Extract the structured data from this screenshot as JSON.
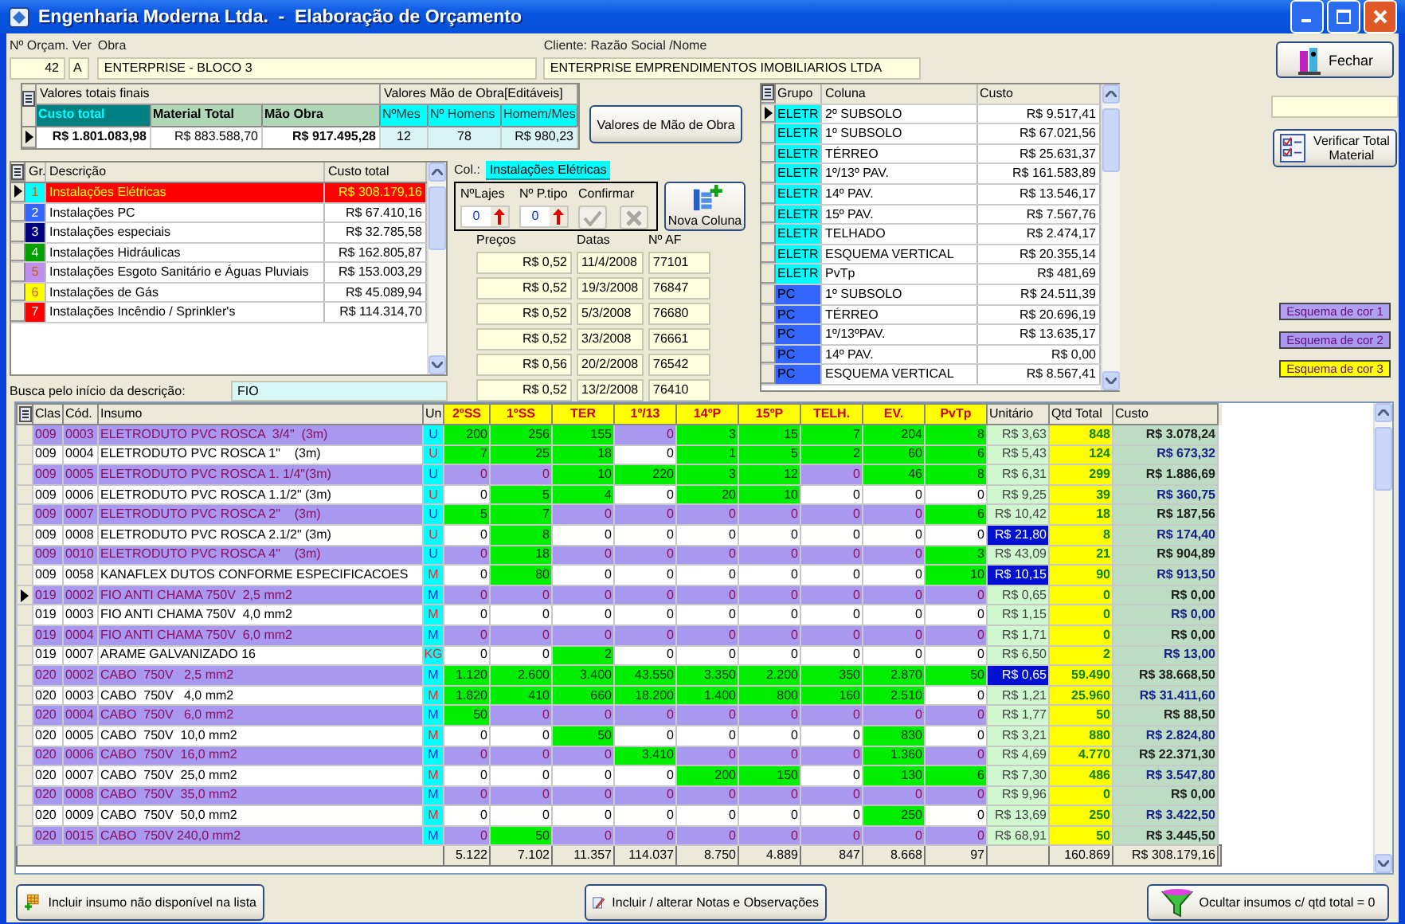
{
  "window": {
    "title": "Engenharia Moderna Ltda.  -  Elaboração de Orçamento"
  },
  "header_fields": {
    "orcamento_label": "Nº Orçam. Ver",
    "orcamento": "42",
    "versao": "A",
    "obra_label": "Obra",
    "obra": "ENTERPRISE - BLOCO 3",
    "cliente_label": "Cliente: Razão Social /Nome",
    "cliente": "ENTERPRISE EMPRENDIMENTOS IMOBILIARIOS LTDA"
  },
  "totals": {
    "title": "Valores totais finais",
    "columns": [
      "Custo total",
      "Material Total",
      "Mão Obra"
    ],
    "values": [
      "R$ 1.801.083,98",
      "R$ 883.588,70",
      "R$ 917.495,28"
    ],
    "labor_title": "Valores Mão de Obra[Editáveis]",
    "labor_columns": [
      "NºMes",
      "Nº Homens",
      "Homem/Mes"
    ],
    "labor_values": [
      "12",
      "78",
      "R$ 980,23"
    ]
  },
  "labor_button": "Valores de Mão de Obra",
  "groups": {
    "columns": [
      "Gr.",
      "Descrição",
      "Custo total"
    ],
    "rows": [
      {
        "gr": "1",
        "descricao": "Instalações Elétricas",
        "custo": "R$ 308.179,16",
        "color": "#00ffff",
        "selected": true
      },
      {
        "gr": "2",
        "descricao": "Instalações PC",
        "custo": "R$ 67.410,16",
        "color": "#3366ff",
        "selected": false
      },
      {
        "gr": "3",
        "descricao": "Instalações especiais",
        "custo": "R$ 32.785,58",
        "color": "#000080",
        "selected": false
      },
      {
        "gr": "4",
        "descricao": "Instalações Hidráulicas",
        "custo": "R$ 162.805,87",
        "color": "#00a000",
        "selected": false
      },
      {
        "gr": "5",
        "descricao": "Instalações Esgoto Sanitário e Águas Pluviais",
        "custo": "R$ 153.003,29",
        "color": "#c090f0",
        "selected": false
      },
      {
        "gr": "6",
        "descricao": "Instalações de Gás",
        "custo": "R$ 45.089,94",
        "color": "#ffff00",
        "selected": false
      },
      {
        "gr": "7",
        "descricao": "Instalações Incêndio / Sprinkler's",
        "custo": "R$ 114.314,70",
        "color": "#ff0000",
        "selected": false
      }
    ]
  },
  "search": {
    "label": "Busca pelo início da descrição:",
    "value": "FIO"
  },
  "column_editor": {
    "col_label": "Col.:",
    "col_value": "Instalações Elétricas",
    "lajes_label": "NºLajes",
    "lajes": "0",
    "ptipo_label": "Nº P.tipo",
    "ptipo": "0",
    "confirm_label": "Confirmar",
    "confirm_disabled": true,
    "new_column": "Nova Coluna"
  },
  "prices": {
    "columns": [
      "Preços",
      "Datas",
      "Nº AF"
    ],
    "rows": [
      [
        "R$ 0,52",
        "11/4/2008",
        "77101"
      ],
      [
        "R$ 0,52",
        "19/3/2008",
        "76847"
      ],
      [
        "R$ 0,52",
        "5/3/2008",
        "76680"
      ],
      [
        "R$ 0,52",
        "3/3/2008",
        "76661"
      ],
      [
        "R$ 0,56",
        "20/2/2008",
        "76542"
      ],
      [
        "R$ 0,52",
        "13/2/2008",
        "76410"
      ]
    ]
  },
  "column_costs": {
    "columns": [
      "Grupo",
      "Coluna",
      "Custo"
    ],
    "rows": [
      {
        "grupo": "ELETR",
        "coluna": "2º SUBSOLO",
        "custo": "R$ 9.517,41",
        "color": "#00ffff",
        "selected": true
      },
      {
        "grupo": "ELETR",
        "coluna": "1º SUBSOLO",
        "custo": "R$ 67.021,56",
        "color": "#00ffff",
        "selected": false
      },
      {
        "grupo": "ELETR",
        "coluna": "TÉRREO",
        "custo": "R$ 25.631,37",
        "color": "#00ffff",
        "selected": false
      },
      {
        "grupo": "ELETR",
        "coluna": "1º/13º PAV.",
        "custo": "R$ 161.583,89",
        "color": "#00ffff",
        "selected": false
      },
      {
        "grupo": "ELETR",
        "coluna": "14º PAV.",
        "custo": "R$ 13.546,17",
        "color": "#00ffff",
        "selected": false
      },
      {
        "grupo": "ELETR",
        "coluna": "15º PAV.",
        "custo": "R$ 7.567,76",
        "color": "#00ffff",
        "selected": false
      },
      {
        "grupo": "ELETR",
        "coluna": "TELHADO",
        "custo": "R$ 2.474,17",
        "color": "#00ffff",
        "selected": false
      },
      {
        "grupo": "ELETR",
        "coluna": "ESQUEMA VERTICAL",
        "custo": "R$ 20.355,14",
        "color": "#00ffff",
        "selected": false
      },
      {
        "grupo": "ELETR",
        "coluna": "PvTp",
        "custo": "R$ 481,69",
        "color": "#00ffff",
        "selected": false
      },
      {
        "grupo": "PC",
        "coluna": "1º SUBSOLO",
        "custo": "R$ 24.511,39",
        "color": "#3366ff",
        "selected": false
      },
      {
        "grupo": "PC",
        "coluna": "TÉRREO",
        "custo": "R$ 20.696,19",
        "color": "#3366ff",
        "selected": false
      },
      {
        "grupo": "PC",
        "coluna": "1º/13ºPAV.",
        "custo": "R$ 13.635,17",
        "color": "#3366ff",
        "selected": false
      },
      {
        "grupo": "PC",
        "coluna": "14º PAV.",
        "custo": "R$ 0,00",
        "color": "#3366ff",
        "selected": false
      },
      {
        "grupo": "PC",
        "coluna": "ESQUEMA VERTICAL",
        "custo": "R$ 8.567,41",
        "color": "#3366ff",
        "selected": false
      }
    ]
  },
  "side": {
    "close_button": "Fechar",
    "verify_button": "Verificar Total Material",
    "schemes": [
      {
        "label": "Esquema de cor 1",
        "color": "#b0a0f0"
      },
      {
        "label": "Esquema de cor 2",
        "color": "#a898f0"
      },
      {
        "label": "Esquema de cor 3",
        "color": "#ffff00"
      }
    ]
  },
  "items": {
    "columns": [
      "Clas",
      "Cód.",
      "Insumo",
      "Un"
    ],
    "qty_columns": [
      "2ºSS",
      "1ºSS",
      "TER",
      "1º/13",
      "14ºP",
      "15ºP",
      "TELH.",
      "EV.",
      "PvTp"
    ],
    "tail_columns": [
      "Unitário",
      "Qtd Total",
      "Custo"
    ],
    "rows": [
      {
        "clas": "009",
        "cod": "0003",
        "insumo": "ELETRODUTO PVC ROSCA  3/4\"  (3m)",
        "un": "U",
        "highlighted": true,
        "selected": false,
        "qty": [
          "200",
          "256",
          "155",
          "0",
          "3",
          "15",
          "7",
          "204",
          "8"
        ],
        "filled": [
          true,
          true,
          true,
          false,
          true,
          true,
          true,
          true,
          true
        ],
        "unit": "R$ 3,63",
        "unit_flagged": false,
        "qtd_total": "848",
        "custo": "R$ 3.078,24"
      },
      {
        "clas": "009",
        "cod": "0004",
        "insumo": "ELETRODUTO PVC ROSCA 1\"    (3m)",
        "un": "U",
        "highlighted": false,
        "selected": false,
        "qty": [
          "7",
          "25",
          "18",
          "0",
          "1",
          "5",
          "2",
          "60",
          "6"
        ],
        "filled": [
          true,
          true,
          true,
          false,
          true,
          true,
          true,
          true,
          true
        ],
        "unit": "R$ 5,43",
        "unit_flagged": false,
        "qtd_total": "124",
        "custo": "R$ 673,32"
      },
      {
        "clas": "009",
        "cod": "0005",
        "insumo": "ELETRODUTO PVC ROSCA 1. 1/4\"(3m)",
        "un": "U",
        "highlighted": true,
        "selected": false,
        "qty": [
          "0",
          "0",
          "10",
          "220",
          "3",
          "12",
          "0",
          "46",
          "8"
        ],
        "filled": [
          false,
          false,
          true,
          true,
          true,
          true,
          false,
          true,
          true
        ],
        "unit": "R$ 6,31",
        "unit_flagged": false,
        "qtd_total": "299",
        "custo": "R$ 1.886,69"
      },
      {
        "clas": "009",
        "cod": "0006",
        "insumo": "ELETRODUTO PVC ROSCA 1.1/2\" (3m)",
        "un": "U",
        "highlighted": false,
        "selected": false,
        "qty": [
          "0",
          "5",
          "4",
          "0",
          "20",
          "10",
          "0",
          "0",
          "0"
        ],
        "filled": [
          false,
          true,
          true,
          false,
          true,
          true,
          false,
          false,
          false
        ],
        "unit": "R$ 9,25",
        "unit_flagged": false,
        "qtd_total": "39",
        "custo": "R$ 360,75"
      },
      {
        "clas": "009",
        "cod": "0007",
        "insumo": "ELETRODUTO PVC ROSCA 2\"    (3m)",
        "un": "U",
        "highlighted": true,
        "selected": false,
        "qty": [
          "5",
          "7",
          "0",
          "0",
          "0",
          "0",
          "0",
          "0",
          "6"
        ],
        "filled": [
          true,
          true,
          false,
          false,
          false,
          false,
          false,
          false,
          true
        ],
        "unit": "R$ 10,42",
        "unit_flagged": false,
        "qtd_total": "18",
        "custo": "R$ 187,56"
      },
      {
        "clas": "009",
        "cod": "0008",
        "insumo": "ELETRODUTO PVC ROSCA 2.1/2\" (3m)",
        "un": "U",
        "highlighted": false,
        "selected": false,
        "qty": [
          "0",
          "8",
          "0",
          "0",
          "0",
          "0",
          "0",
          "0",
          "0"
        ],
        "filled": [
          false,
          true,
          false,
          false,
          false,
          false,
          false,
          false,
          false
        ],
        "unit": "R$ 21,80",
        "unit_flagged": true,
        "qtd_total": "8",
        "custo": "R$ 174,40"
      },
      {
        "clas": "009",
        "cod": "0010",
        "insumo": "ELETRODUTO PVC ROSCA 4\"    (3m)",
        "un": "U",
        "highlighted": true,
        "selected": false,
        "qty": [
          "0",
          "18",
          "0",
          "0",
          "0",
          "0",
          "0",
          "0",
          "3"
        ],
        "filled": [
          false,
          true,
          false,
          false,
          false,
          false,
          false,
          false,
          true
        ],
        "unit": "R$ 43,09",
        "unit_flagged": false,
        "qtd_total": "21",
        "custo": "R$ 904,89"
      },
      {
        "clas": "009",
        "cod": "0058",
        "insumo": "KANAFLEX DUTOS CONFORME ESPECIFICACOES",
        "un": "M",
        "highlighted": false,
        "selected": false,
        "qty": [
          "0",
          "80",
          "0",
          "0",
          "0",
          "0",
          "0",
          "0",
          "10"
        ],
        "filled": [
          false,
          true,
          false,
          false,
          false,
          false,
          false,
          false,
          true
        ],
        "unit": "R$ 10,15",
        "unit_flagged": true,
        "qtd_total": "90",
        "custo": "R$ 913,50"
      },
      {
        "clas": "019",
        "cod": "0002",
        "insumo": "FIO ANTI CHAMA 750V  2,5 mm2",
        "un": "M",
        "highlighted": true,
        "selected": true,
        "qty": [
          "0",
          "0",
          "0",
          "0",
          "0",
          "0",
          "0",
          "0",
          "0"
        ],
        "filled": [
          false,
          false,
          false,
          false,
          false,
          false,
          false,
          false,
          false
        ],
        "unit": "R$ 0,65",
        "unit_flagged": false,
        "qtd_total": "0",
        "custo": "R$ 0,00"
      },
      {
        "clas": "019",
        "cod": "0003",
        "insumo": "FIO ANTI CHAMA 750V  4,0 mm2",
        "un": "M",
        "highlighted": false,
        "selected": false,
        "qty": [
          "0",
          "0",
          "0",
          "0",
          "0",
          "0",
          "0",
          "0",
          "0"
        ],
        "filled": [
          false,
          false,
          false,
          false,
          false,
          false,
          false,
          false,
          false
        ],
        "unit": "R$ 1,15",
        "unit_flagged": false,
        "qtd_total": "0",
        "custo": "R$ 0,00"
      },
      {
        "clas": "019",
        "cod": "0004",
        "insumo": "FIO ANTI CHAMA 750V  6,0 mm2",
        "un": "M",
        "highlighted": true,
        "selected": false,
        "qty": [
          "0",
          "0",
          "0",
          "0",
          "0",
          "0",
          "0",
          "0",
          "0"
        ],
        "filled": [
          false,
          false,
          false,
          false,
          false,
          false,
          false,
          false,
          false
        ],
        "unit": "R$ 1,71",
        "unit_flagged": false,
        "qtd_total": "0",
        "custo": "R$ 0,00"
      },
      {
        "clas": "019",
        "cod": "0007",
        "insumo": "ARAME GALVANIZADO 16",
        "un": "KG",
        "highlighted": false,
        "selected": false,
        "qty": [
          "0",
          "0",
          "2",
          "0",
          "0",
          "0",
          "0",
          "0",
          "0"
        ],
        "filled": [
          false,
          false,
          true,
          false,
          false,
          false,
          false,
          false,
          false
        ],
        "unit": "R$ 6,50",
        "unit_flagged": false,
        "qtd_total": "2",
        "custo": "R$ 13,00"
      },
      {
        "clas": "020",
        "cod": "0002",
        "insumo": "CABO  750V   2,5 mm2",
        "un": "M",
        "highlighted": true,
        "selected": false,
        "qty": [
          "1.120",
          "2.600",
          "3.400",
          "43.550",
          "3.350",
          "2.200",
          "350",
          "2.870",
          "50"
        ],
        "filled": [
          true,
          true,
          true,
          true,
          true,
          true,
          true,
          true,
          true
        ],
        "unit": "R$ 0,65",
        "unit_flagged": true,
        "qtd_total": "59.490",
        "custo": "R$ 38.668,50"
      },
      {
        "clas": "020",
        "cod": "0003",
        "insumo": "CABO  750V   4,0 mm2",
        "un": "M",
        "highlighted": false,
        "selected": false,
        "qty": [
          "1.820",
          "410",
          "660",
          "18.200",
          "1.400",
          "800",
          "160",
          "2.510",
          "0"
        ],
        "filled": [
          true,
          true,
          true,
          true,
          true,
          true,
          true,
          true,
          false
        ],
        "unit": "R$ 1,21",
        "unit_flagged": false,
        "qtd_total": "25.960",
        "custo": "R$ 31.411,60"
      },
      {
        "clas": "020",
        "cod": "0004",
        "insumo": "CABO  750V   6,0 mm2",
        "un": "M",
        "highlighted": true,
        "selected": false,
        "qty": [
          "50",
          "0",
          "0",
          "0",
          "0",
          "0",
          "0",
          "0",
          "0"
        ],
        "filled": [
          true,
          false,
          false,
          false,
          false,
          false,
          false,
          false,
          false
        ],
        "unit": "R$ 1,77",
        "unit_flagged": false,
        "qtd_total": "50",
        "custo": "R$ 88,50"
      },
      {
        "clas": "020",
        "cod": "0005",
        "insumo": "CABO  750V  10,0 mm2",
        "un": "M",
        "highlighted": false,
        "selected": false,
        "qty": [
          "0",
          "0",
          "50",
          "0",
          "0",
          "0",
          "0",
          "830",
          "0"
        ],
        "filled": [
          false,
          false,
          true,
          false,
          false,
          false,
          false,
          true,
          false
        ],
        "unit": "R$ 3,21",
        "unit_flagged": false,
        "qtd_total": "880",
        "custo": "R$ 2.824,80"
      },
      {
        "clas": "020",
        "cod": "0006",
        "insumo": "CABO  750V  16,0 mm2",
        "un": "M",
        "highlighted": true,
        "selected": false,
        "qty": [
          "0",
          "0",
          "0",
          "3.410",
          "0",
          "0",
          "0",
          "1.360",
          "0"
        ],
        "filled": [
          false,
          false,
          false,
          true,
          false,
          false,
          false,
          true,
          false
        ],
        "unit": "R$ 4,69",
        "unit_flagged": false,
        "qtd_total": "4.770",
        "custo": "R$ 22.371,30"
      },
      {
        "clas": "020",
        "cod": "0007",
        "insumo": "CABO  750V  25,0 mm2",
        "un": "M",
        "highlighted": false,
        "selected": false,
        "qty": [
          "0",
          "0",
          "0",
          "0",
          "200",
          "150",
          "0",
          "130",
          "6"
        ],
        "filled": [
          false,
          false,
          false,
          false,
          true,
          true,
          false,
          true,
          true
        ],
        "unit": "R$ 7,30",
        "unit_flagged": false,
        "qtd_total": "486",
        "custo": "R$ 3.547,80"
      },
      {
        "clas": "020",
        "cod": "0008",
        "insumo": "CABO  750V  35,0 mm2",
        "un": "M",
        "highlighted": true,
        "selected": false,
        "qty": [
          "0",
          "0",
          "0",
          "0",
          "0",
          "0",
          "0",
          "0",
          "0"
        ],
        "filled": [
          false,
          false,
          false,
          false,
          false,
          false,
          false,
          false,
          false
        ],
        "unit": "R$ 9,96",
        "unit_flagged": false,
        "qtd_total": "0",
        "custo": "R$ 0,00"
      },
      {
        "clas": "020",
        "cod": "0009",
        "insumo": "CABO  750V  50,0 mm2",
        "un": "M",
        "highlighted": false,
        "selected": false,
        "qty": [
          "0",
          "0",
          "0",
          "0",
          "0",
          "0",
          "0",
          "250",
          "0"
        ],
        "filled": [
          false,
          false,
          false,
          false,
          false,
          false,
          false,
          true,
          false
        ],
        "unit": "R$ 13,69",
        "unit_flagged": false,
        "qtd_total": "250",
        "custo": "R$ 3.422,50"
      },
      {
        "clas": "020",
        "cod": "0015",
        "insumo": "CABO  750V 240,0 mm2",
        "un": "M",
        "highlighted": true,
        "selected": false,
        "qty": [
          "0",
          "50",
          "0",
          "0",
          "0",
          "0",
          "0",
          "0",
          "0"
        ],
        "filled": [
          false,
          true,
          false,
          false,
          false,
          false,
          false,
          false,
          false
        ],
        "unit": "R$ 68,91",
        "unit_flagged": false,
        "qtd_total": "50",
        "custo": "R$ 3.445,50"
      }
    ],
    "totals": {
      "qty": [
        "5.122",
        "7.102",
        "11.357",
        "114.037",
        "8.750",
        "4.889",
        "847",
        "8.668",
        "97"
      ],
      "qtd_total": "160.869",
      "custo": "R$ 308.179,16"
    }
  },
  "buttons": [
    "Incluir insumo não disponível na lista",
    "Incluir / alterar Notas e Observações",
    "Ocultar insumos c/ qtd total = 0"
  ]
}
